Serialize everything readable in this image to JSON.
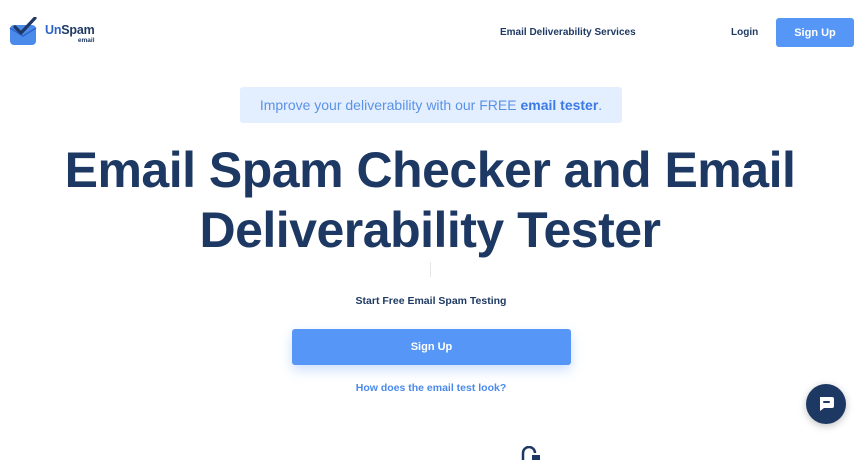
{
  "header": {
    "logo": {
      "name_part1": "Un",
      "name_part2": "Spam",
      "sub": "email",
      "icon": "envelope-check-icon"
    },
    "nav": {
      "services": "Email Deliverability Services",
      "login": "Login",
      "signup": "Sign Up"
    }
  },
  "promo": {
    "text": "Improve your deliverability with our FREE ",
    "link": "email tester",
    "suffix": "."
  },
  "hero": {
    "title_line1": "Email Spam Checker and Email",
    "title_line2": "Deliverability Tester",
    "start_text": "Start Free Email Spam Testing",
    "signup_label": "Sign Up",
    "how_link": "How does the email test look?"
  },
  "chat": {
    "icon": "chat-bubble-icon"
  },
  "colors": {
    "accent": "#5596f6",
    "navy": "#1d3963",
    "promo_bg": "#e3eefe"
  }
}
